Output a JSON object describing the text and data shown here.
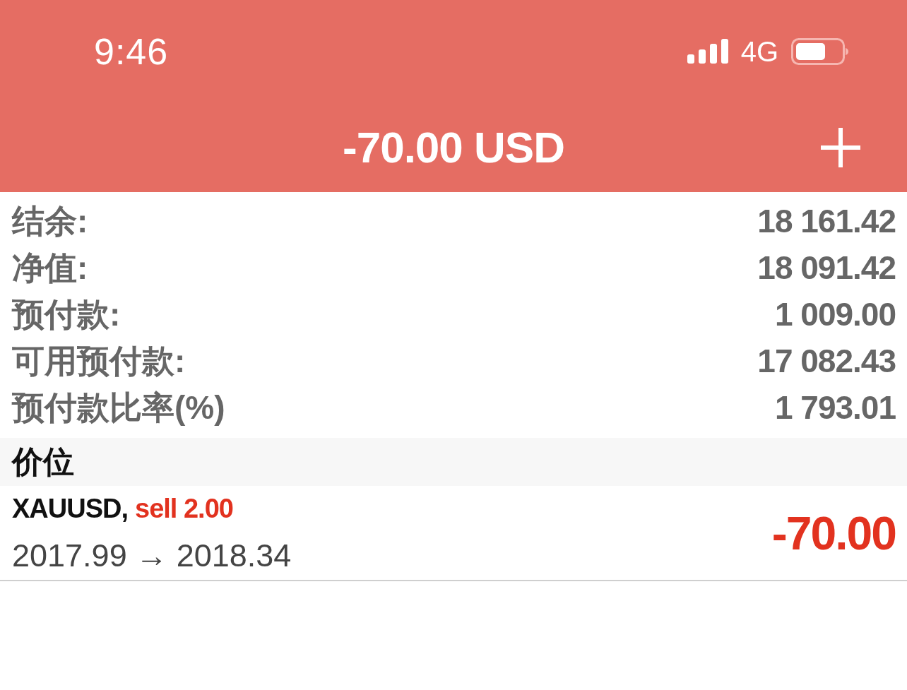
{
  "status_bar": {
    "time": "9:46",
    "network": "4G"
  },
  "header": {
    "title": "-70.00 USD"
  },
  "summary": [
    {
      "label": "结余:",
      "value": "18 161.42"
    },
    {
      "label": "净值:",
      "value": "18 091.42"
    },
    {
      "label": "预付款:",
      "value": "1 009.00"
    },
    {
      "label": "可用预付款:",
      "value": "17 082.43"
    },
    {
      "label": "预付款比率(%)",
      "value": "1 793.01"
    }
  ],
  "section": {
    "title": "价位"
  },
  "positions": [
    {
      "symbol": "XAUUSD,",
      "order": "sell 2.00",
      "prices": "2017.99 → 2018.34",
      "profit": "-70.00"
    }
  ]
}
